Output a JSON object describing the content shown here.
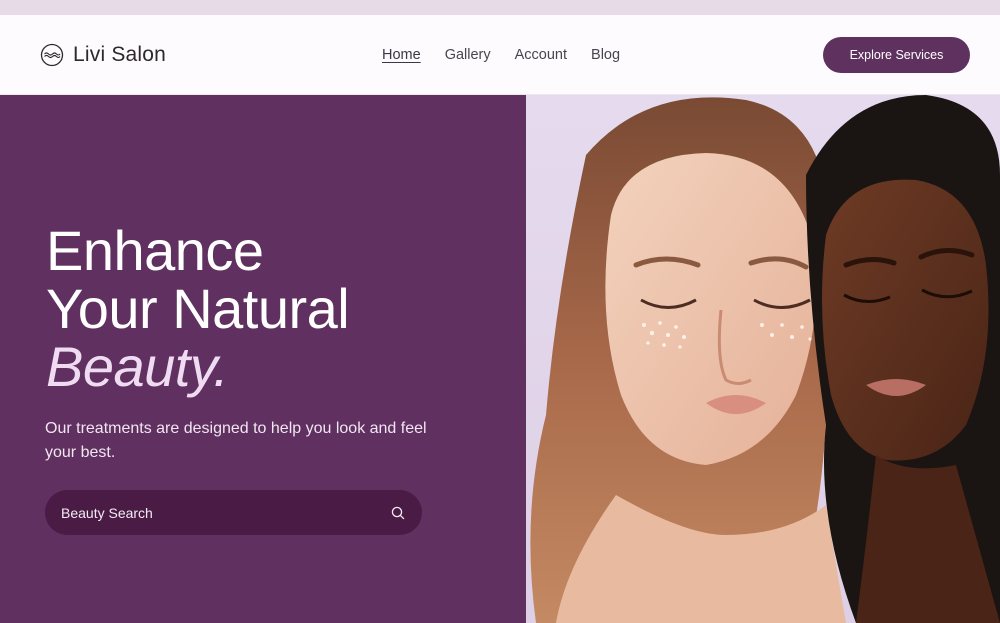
{
  "brand": {
    "name": "Livi Salon",
    "logo_icon": "wave-circle-logo-icon"
  },
  "nav": {
    "items": [
      {
        "label": "Home",
        "active": true
      },
      {
        "label": "Gallery",
        "active": false
      },
      {
        "label": "Account",
        "active": false
      },
      {
        "label": "Blog",
        "active": false
      }
    ]
  },
  "header": {
    "cta_label": "Explore Services"
  },
  "hero": {
    "headline_line1": "Enhance",
    "headline_line2": "Your Natural",
    "headline_accent": "Beauty.",
    "subtext": "Our treatments are designed to help you look and feel your best.",
    "search_placeholder": "Beauty Search",
    "search_icon": "search-icon"
  },
  "colors": {
    "primary": "#5f3060",
    "button": "#5f315f",
    "search_bg": "#4a1c45",
    "accent_text": "#efdcf2",
    "image_bg": "#e6daee"
  }
}
